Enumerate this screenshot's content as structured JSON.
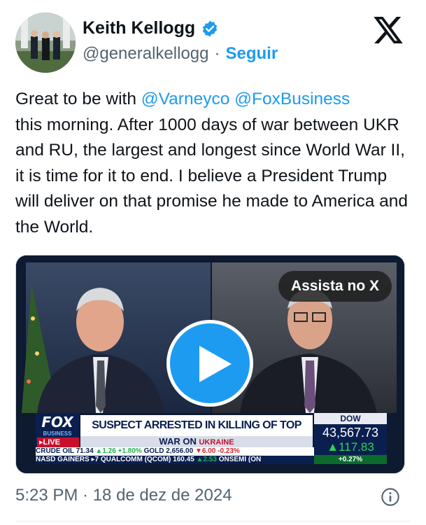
{
  "author": {
    "name": "Keith Kellogg",
    "handle": "@generalkellogg",
    "separator": "·",
    "follow_label": "Seguir",
    "avatar_icon": "profile-photo",
    "verified_icon": "verified-badge-icon"
  },
  "brand_icon": "x-logo-icon",
  "tweet": {
    "text_before": "Great to be with ",
    "mention1": "@Varneyco",
    "text_space": " ",
    "mention2": "@FoxBusiness",
    "text_after": "\nthis morning.  After 1000 days of war between UKR and RU, the largest and longest since World War II, it is time for it to end. I believe a President Trump will deliver on that promise he made to America and the World."
  },
  "media": {
    "watch_label": "Assista no X",
    "play_icon": "play-icon",
    "ticker": {
      "logo": "FOX",
      "logo_sub": "BUSINESS",
      "live": "▸LIVE",
      "headline": "SUSPECT ARRESTED IN KILLING OF TOP RUSSIAN GENERAL",
      "war_label": "WAR ON",
      "war_region": "UKRAINE",
      "crude_row": {
        "crude_label": "CRUDE OIL",
        "crude_value": "71.34",
        "crude_change": "▲1.26",
        "crude_pct": "+1.80%",
        "gold_label": "GOLD",
        "gold_value": "2,656.00",
        "gold_change": "▼6.00",
        "gold_pct": "-0.23%"
      },
      "gainers_row": {
        "label": "NASD GAINERS",
        "rank": "▸7",
        "stock": "QUALCOMM (QCOM)",
        "price": "160.45",
        "change": "▲2.53",
        "next": "ONSEMI (ON"
      },
      "dow": {
        "label": "DOW",
        "value": "43,567.73",
        "change": "▲117.83",
        "pct": "+0.27%"
      }
    }
  },
  "timestamp": "5:23 PM · 18 de dez de 2024",
  "info_icon": "info-icon",
  "colors": {
    "accent": "#1d9bf0",
    "text": "#0f1419",
    "secondary": "#536471"
  }
}
